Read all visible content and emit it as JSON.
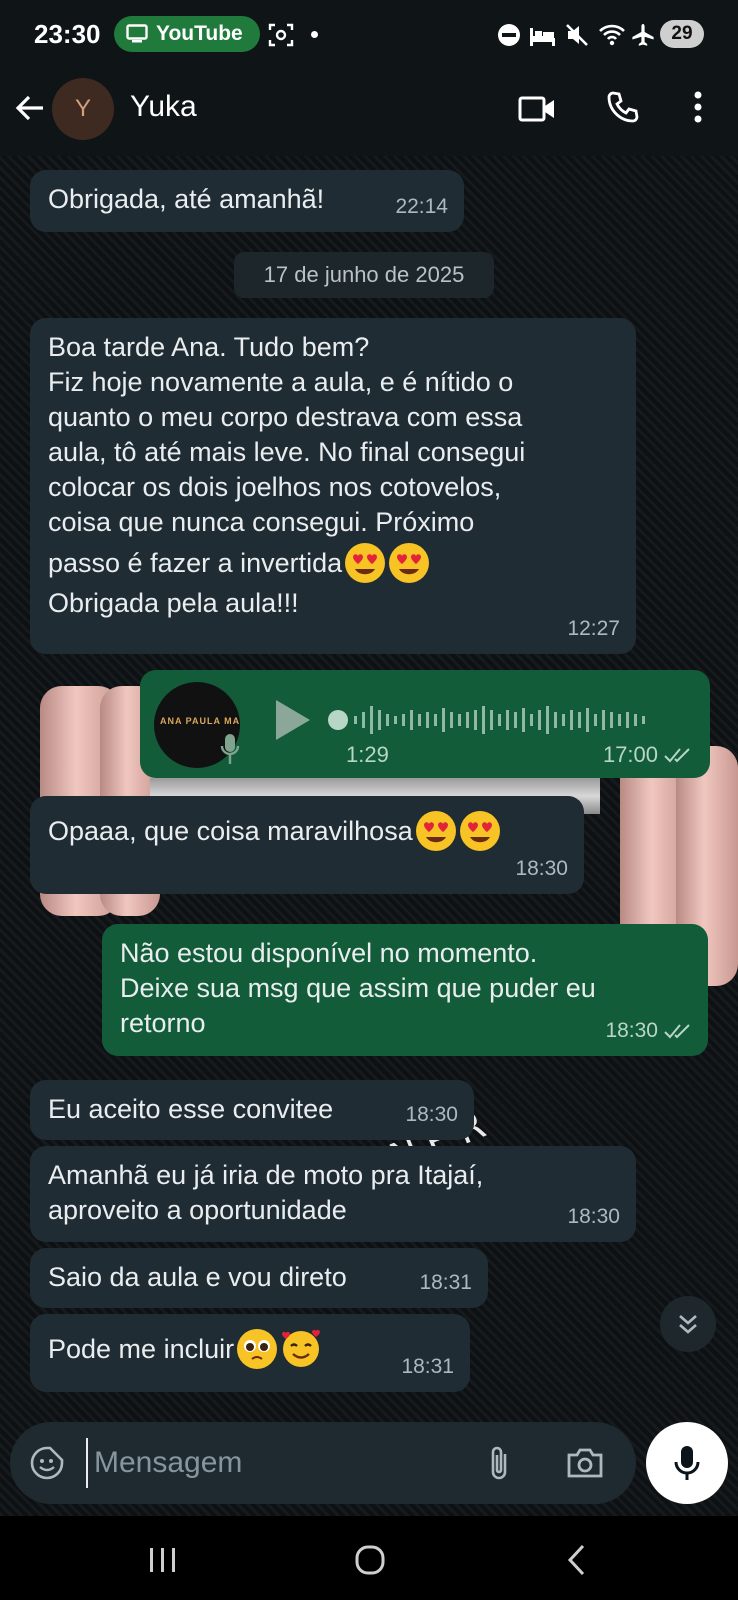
{
  "status_bar": {
    "time": "23:30",
    "pill_label": "YouTube",
    "battery": "29",
    "icons": [
      "monitor-icon",
      "screen-record-icon",
      "dnd-icon",
      "sleep-icon",
      "mute-icon",
      "wifi-icon",
      "airplane-icon"
    ]
  },
  "header": {
    "avatar_letter": "Y",
    "contact_name": "Yuka",
    "icons": [
      "back-arrow-icon",
      "video-call-icon",
      "phone-icon",
      "more-vert-icon"
    ]
  },
  "messages": [
    {
      "dir": "in",
      "lines": [
        "Obrigada, até amanhã!"
      ],
      "time": "22:14"
    },
    {
      "date_chip": "17 de junho de 2025"
    },
    {
      "dir": "in",
      "lines": [
        "Boa tarde Ana. Tudo bem?",
        "Fiz hoje novamente a aula, e é nítido o",
        "quanto o meu corpo destrava com essa",
        "aula, tô até mais leve. No final consegui",
        "colocar os dois joelhos nos cotovelos,",
        "coisa que nunca consegui. Próximo",
        "passo é fazer a invertida",
        "Obrigada pela aula!!!"
      ],
      "emoji": [
        "heart-eyes",
        "heart-eyes"
      ],
      "time": "12:27"
    },
    {
      "dir": "out",
      "type": "voice",
      "avatar_text": "ANA PAULA MACHADO",
      "duration": "1:29",
      "time": "17:00",
      "read": true
    },
    {
      "dir": "in",
      "lines": [
        "Opaaa, que coisa maravilhosa"
      ],
      "emoji": [
        "heart-eyes",
        "heart-eyes"
      ],
      "time": "18:30"
    },
    {
      "dir": "out",
      "lines": [
        "Não estou disponível no momento.",
        "Deixe sua msg que assim que puder eu",
        "retorno"
      ],
      "time": "18:30",
      "read": true
    },
    {
      "dir": "in",
      "lines": [
        "Eu aceito esse convitee"
      ],
      "time": "18:30"
    },
    {
      "dir": "in",
      "lines": [
        "Amanhã eu já iria de moto pra Itajaí,",
        "aproveito a oportunidade"
      ],
      "time": "18:30"
    },
    {
      "dir": "in",
      "lines": [
        "Saio da aula e vou direto"
      ],
      "time": "18:31"
    },
    {
      "dir": "in",
      "lines": [
        "Pode me incluir"
      ],
      "emoji": [
        "pleading",
        "smiling-hearts"
      ],
      "time": "18:31"
    }
  ],
  "wallpaper_text": "TRAINER",
  "input": {
    "placeholder": "Mensagem",
    "value": ""
  },
  "colors": {
    "incoming": "#202c33",
    "outgoing": "#125c3a",
    "header": "#0f1416",
    "mic_button": "#ffffff"
  }
}
